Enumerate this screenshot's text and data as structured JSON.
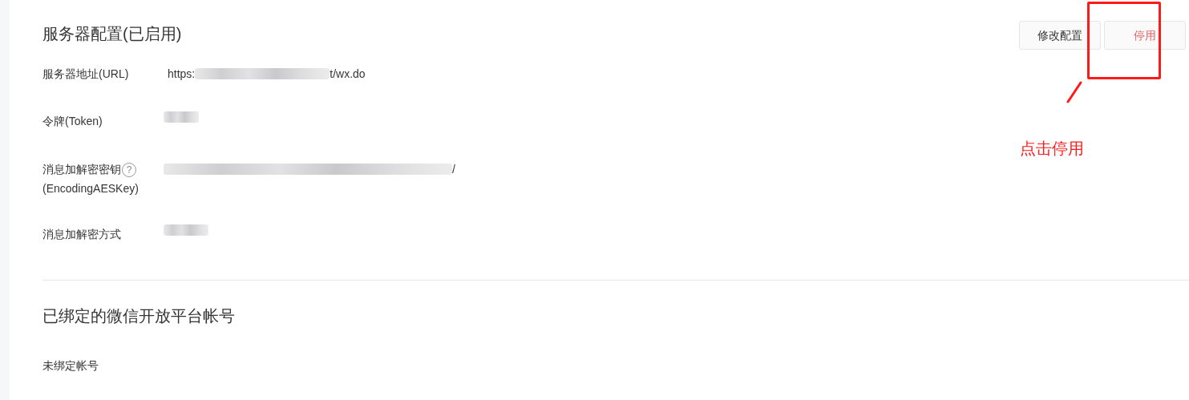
{
  "server_config": {
    "title": "服务器配置(已启用)",
    "buttons": [
      {
        "label": "修改配置",
        "kind": "default"
      },
      {
        "label": "停用",
        "kind": "danger"
      }
    ],
    "fields": [
      {
        "label": "服务器地址(URL)",
        "value_start": "https:",
        "value_end": "t/wx.do",
        "redacted": true
      },
      {
        "label": "令牌(Token)",
        "redacted": true
      },
      {
        "label": "消息加解密密钥",
        "help": "?",
        "sublabel": "(EncodingAESKey)",
        "value_end": "/",
        "redacted": true
      },
      {
        "label": "消息加解密方式",
        "redacted": true
      }
    ]
  },
  "open_platform": {
    "title": "已绑定的微信开放平台帐号",
    "status": "未绑定帐号"
  },
  "annotation": {
    "note": "点击停用"
  }
}
